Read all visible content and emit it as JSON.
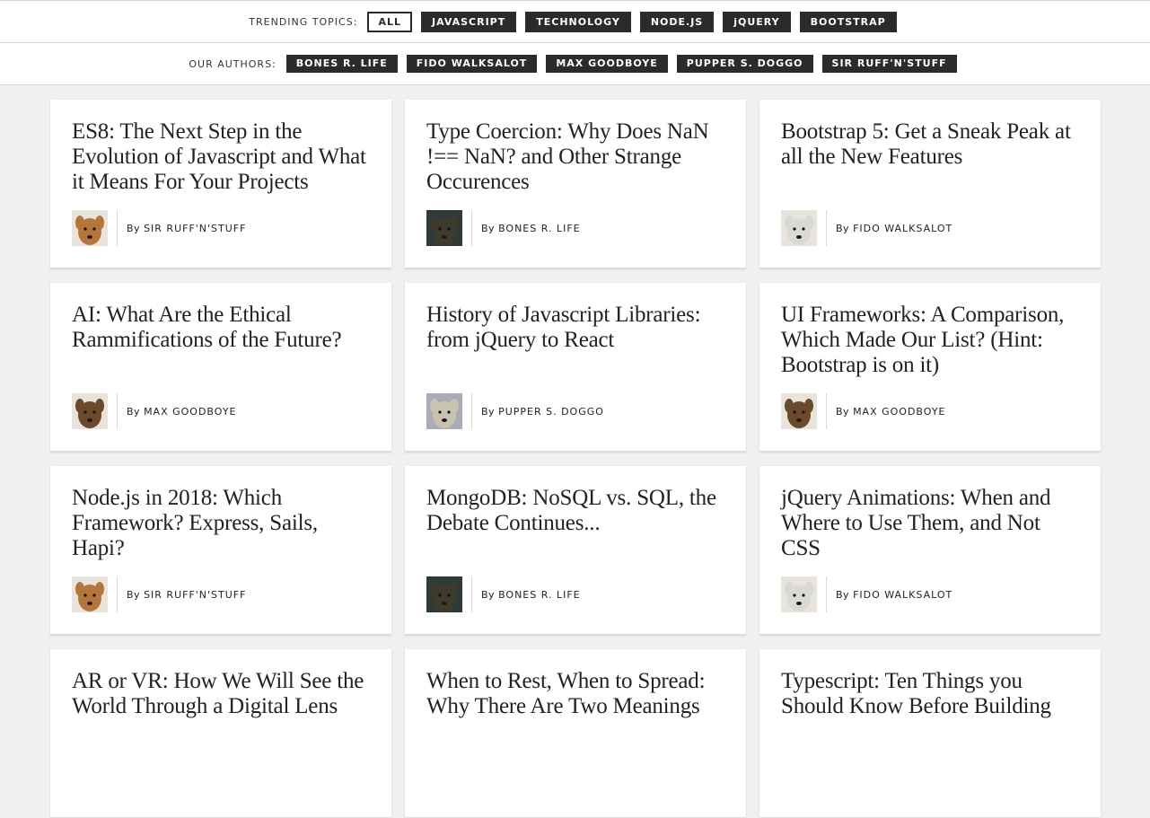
{
  "topics": {
    "label": "TRENDING TOPICS:",
    "items": [
      "ALL",
      "JAVASCRIPT",
      "TECHNOLOGY",
      "NODE.JS",
      "jQUERY",
      "BOOTSTRAP"
    ],
    "active": "ALL"
  },
  "authors": {
    "label": "OUR AUTHORS:",
    "items": [
      "BONES R. LIFE",
      "FIDO WALKSALOT",
      "MAX GOODBOYE",
      "PUPPER S. DOGGO",
      "SIR RUFF'N'STUFF"
    ]
  },
  "by_prefix": "By",
  "posts": [
    {
      "title": "ES8: The Next Step in the Evolution of Javascript and What it Means For Your Projects",
      "author": "SIR RUFF'N'STUFF",
      "avatar": "ruff"
    },
    {
      "title": "Type Coercion: Why Does NaN !== NaN? and Other Strange Occurences",
      "author": "BONES R. LIFE",
      "avatar": "bones"
    },
    {
      "title": "Bootstrap 5: Get a Sneak Peak at all the New Features",
      "author": "FIDO WALKSALOT",
      "avatar": "fido"
    },
    {
      "title": "AI: What Are the Ethical Rammifications of the Future?",
      "author": "MAX GOODBOYE",
      "avatar": "max"
    },
    {
      "title": "History of Javascript Libraries: from jQuery to React",
      "author": "PUPPER S. DOGGO",
      "avatar": "pupper"
    },
    {
      "title": "UI Frameworks: A Comparison, Which Made Our List? (Hint: Bootstrap is on it)",
      "author": "MAX GOODBOYE",
      "avatar": "max"
    },
    {
      "title": "Node.js in 2018: Which Framework? Express, Sails, Hapi?",
      "author": "SIR RUFF'N'STUFF",
      "avatar": "ruff"
    },
    {
      "title": "MongoDB: NoSQL vs. SQL, the Debate Continues...",
      "author": "BONES R. LIFE",
      "avatar": "bones"
    },
    {
      "title": "jQuery Animations: When and Where to Use Them, and Not CSS",
      "author": "FIDO WALKSALOT",
      "avatar": "fido"
    },
    {
      "title": "AR or VR: How We Will See the World Through a Digital Lens",
      "author": "",
      "avatar": ""
    },
    {
      "title": "When to Rest, When to Spread: Why There Are Two Meanings",
      "author": "",
      "avatar": ""
    },
    {
      "title": "Typescript: Ten Things you Should Know Before Building",
      "author": "",
      "avatar": ""
    }
  ],
  "avatar_colors": {
    "ruff": "#b5763a",
    "bones": "#3e3a2c",
    "fido": "#d9d9d6",
    "max": "#6b4a2b",
    "pupper": "#c9c2ae"
  }
}
